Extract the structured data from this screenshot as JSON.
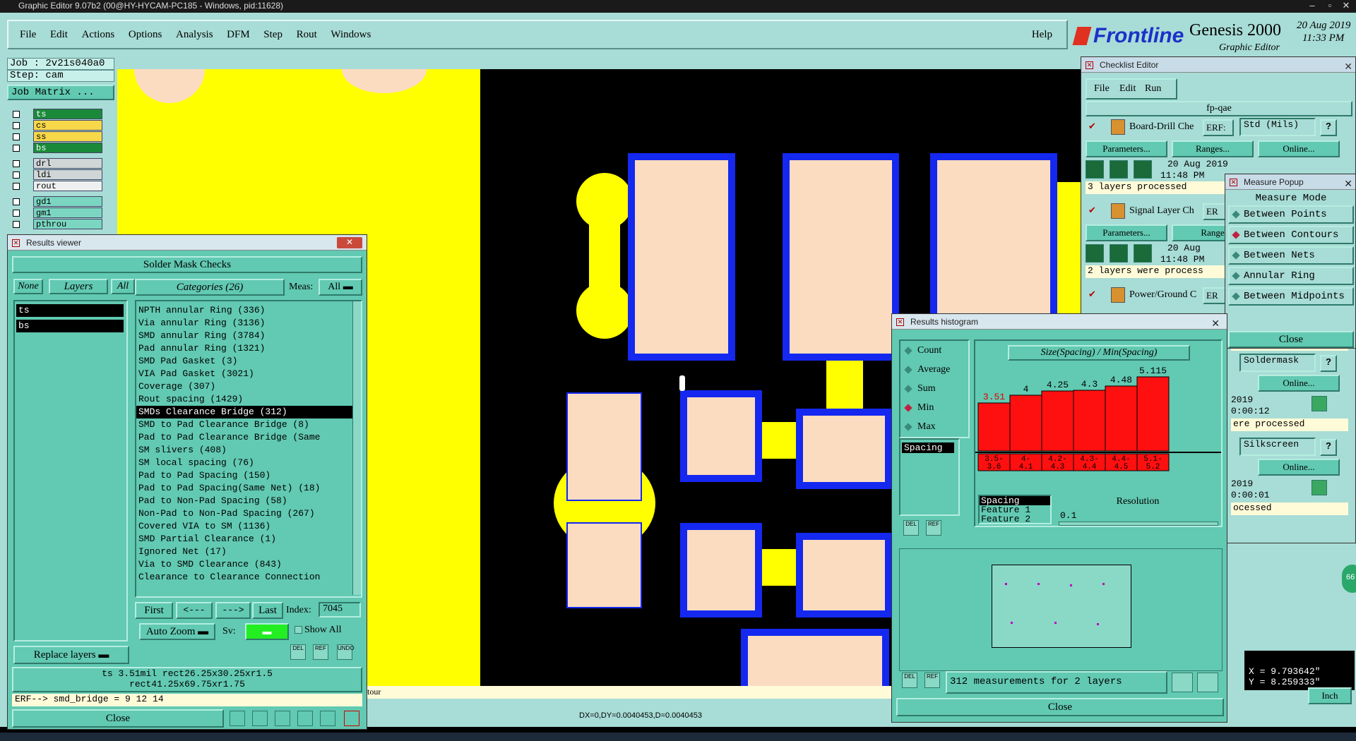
{
  "title_bar": {
    "text": "Graphic Editor 9.07b2 (00@HY-HYCAM-PC185 - Windows, pid:11628)"
  },
  "menu": {
    "items": [
      "File",
      "Edit",
      "Actions",
      "Options",
      "Analysis",
      "DFM",
      "Step",
      "Rout",
      "Windows"
    ],
    "help": "Help"
  },
  "logo": {
    "brand": "Frontline",
    "product": "Genesis 2000",
    "sub": "Graphic Editor",
    "date": "20 Aug 2019",
    "time": "11:33 PM"
  },
  "job": {
    "job": "Job : 2v21s040a0",
    "step": "Step: cam",
    "matrix_button": "Job Matrix ..."
  },
  "layers": [
    {
      "name": "ts",
      "color": "#1a8a3a",
      "text": "#fff"
    },
    {
      "name": "cs",
      "color": "#f7d84a",
      "text": "#000"
    },
    {
      "name": "ss",
      "color": "#f7d84a",
      "text": "#000"
    },
    {
      "name": "bs",
      "color": "#1a8a3a",
      "text": "#fff"
    },
    {
      "name": "drl",
      "color": "#cfd6d6",
      "text": "#000"
    },
    {
      "name": "ldi",
      "color": "#cfd6d6",
      "text": "#000"
    },
    {
      "name": "rout",
      "color": "#eef0f0",
      "text": "#000"
    },
    {
      "name": "gd1",
      "color": "#7ad6c0",
      "text": "#000"
    },
    {
      "name": "gm1",
      "color": "#7ad6c0",
      "text": "#000"
    },
    {
      "name": "pthrou",
      "color": "#7ad6c0",
      "text": "#000"
    }
  ],
  "results_viewer": {
    "title": "Results viewer",
    "header": "Solder Mask Checks",
    "tab_none": "None",
    "tab_layers": "Layers",
    "tab_all": "All",
    "categories_label": "Categories (26)",
    "meas_label": "Meas:",
    "meas_value": "All",
    "layer_list": [
      "ts",
      "bs"
    ],
    "categories": [
      "NPTH annular Ring (336)",
      "Via annular Ring (3136)",
      "SMD annular Ring (3784)",
      "Pad annular Ring (1321)",
      "SMD Pad Gasket (3)",
      "VIA Pad Gasket (3021)",
      "Coverage (307)",
      "Rout spacing (1429)",
      "SMDs Clearance Bridge (312)",
      "SMD to Pad Clearance Bridge (8)",
      "Pad to Pad Clearance Bridge (Same",
      "SM slivers (408)",
      "SM local spacing (76)",
      "Pad to Pad Spacing (150)",
      "Pad to Pad Spacing(Same Net) (18)",
      "Pad to Non-Pad Spacing (58)",
      "Non-Pad to Non-Pad Spacing (267)",
      "Covered VIA to SM (1136)",
      "SMD Partial Clearance (1)",
      "Ignored Net (17)",
      "Via to SMD Clearance (843)",
      "Clearance to Clearance Connection"
    ],
    "selected_index": 8,
    "nav": {
      "first": "First",
      "prev": "<---",
      "next": "--->",
      "last": "Last",
      "index_label": "Index:",
      "index_value": "7045"
    },
    "auto_zoom": "Auto Zoom",
    "sv_label": "Sv:",
    "show_all": "Show All",
    "replace_layers": "Replace layers",
    "del": "DEL",
    "ref": "REF",
    "undo": "UNDO",
    "info_line1": "ts 3.51mil  rect26.25x30.25xr1.5",
    "info_line2": "rect41.25x69.75xr1.75",
    "erf": "ERF--> smd_bridge = 9 12 14",
    "close": "Close"
  },
  "checklist": {
    "title": "Checklist Editor",
    "menu": [
      "File",
      "Edit",
      "Run"
    ],
    "name": "fp-qae",
    "items": [
      {
        "label": "Board-Drill Che",
        "erf": "ERF:",
        "erf_value": "Std (Mils)",
        "date": "20 Aug 2019",
        "time": "11:48 PM",
        "status": "3 layers processed"
      },
      {
        "label": "Signal Layer Ch",
        "erf": "ER",
        "erf_value": "",
        "date": "20 Aug",
        "time": "11:48 PM",
        "status": "2 layers were process"
      },
      {
        "label": "Power/Ground C",
        "erf": "ER",
        "erf_value": "",
        "date": "",
        "time": "",
        "status": ""
      }
    ],
    "buttons": {
      "parameters": "Parameters...",
      "ranges": "Ranges...",
      "online": "Online...",
      "ranges_short": "Range"
    },
    "right_items": [
      {
        "status_top": "processed",
        "erf_value": "Soldermask",
        "online": "Online...",
        "date": "2019",
        "time": "0:00:12",
        "status": "ere processed"
      },
      {
        "erf_value": "Silkscreen",
        "online": "Online...",
        "date": "2019",
        "time": "0:00:01",
        "status": "ocessed"
      }
    ]
  },
  "measure_popup": {
    "title": "Measure Popup",
    "mode_label": "Measure Mode",
    "modes": [
      "Between Points",
      "Between Contours",
      "Between Nets",
      "Annular Ring",
      "Between Midpoints"
    ],
    "selected_mode": 1,
    "close": "Close"
  },
  "histogram": {
    "title": "Results histogram",
    "modes": [
      "Count",
      "Average",
      "Sum",
      "Min",
      "Max"
    ],
    "selected_mode": 3,
    "list_item": "Spacing",
    "chart_title": "Size(Spacing) / Min(Spacing)",
    "bars": [
      {
        "value": "3.51",
        "range": "3.5-\n3.6",
        "level": 0.53,
        "highlight": true
      },
      {
        "value": "4",
        "range": "4-\n4.1",
        "level": 0.62,
        "highlight": false
      },
      {
        "value": "4.25",
        "range": "4.2-\n4.3",
        "level": 0.66,
        "highlight": false
      },
      {
        "value": "4.3",
        "range": "4.3-\n4.4",
        "level": 0.67,
        "highlight": false
      },
      {
        "value": "4.48",
        "range": "4.4-\n4.5",
        "level": 0.72,
        "highlight": false
      },
      {
        "value": "5.115",
        "range": "5.1-\n5.2",
        "level": 0.82,
        "highlight": false
      }
    ],
    "attr_list": [
      "Spacing",
      "Feature 1",
      "Feature 2"
    ],
    "resolution_label": "Resolution",
    "resolution_value": "0.1",
    "summary": "312 measurements for 2 layers",
    "close": "Close"
  },
  "status": {
    "tour": "tour",
    "delta": "DX=0,DY=0.0040453,D=0.0040453",
    "x": "X = 9.793642\"",
    "y": "Y = 8.259333\"",
    "units": "Inch",
    "circle": "66"
  },
  "colors": {
    "pad": "#fcdcc0",
    "mask": "#1428f0",
    "yellow": "#ffff00",
    "panel": "#62c9b2",
    "bar": "#ff1010"
  }
}
